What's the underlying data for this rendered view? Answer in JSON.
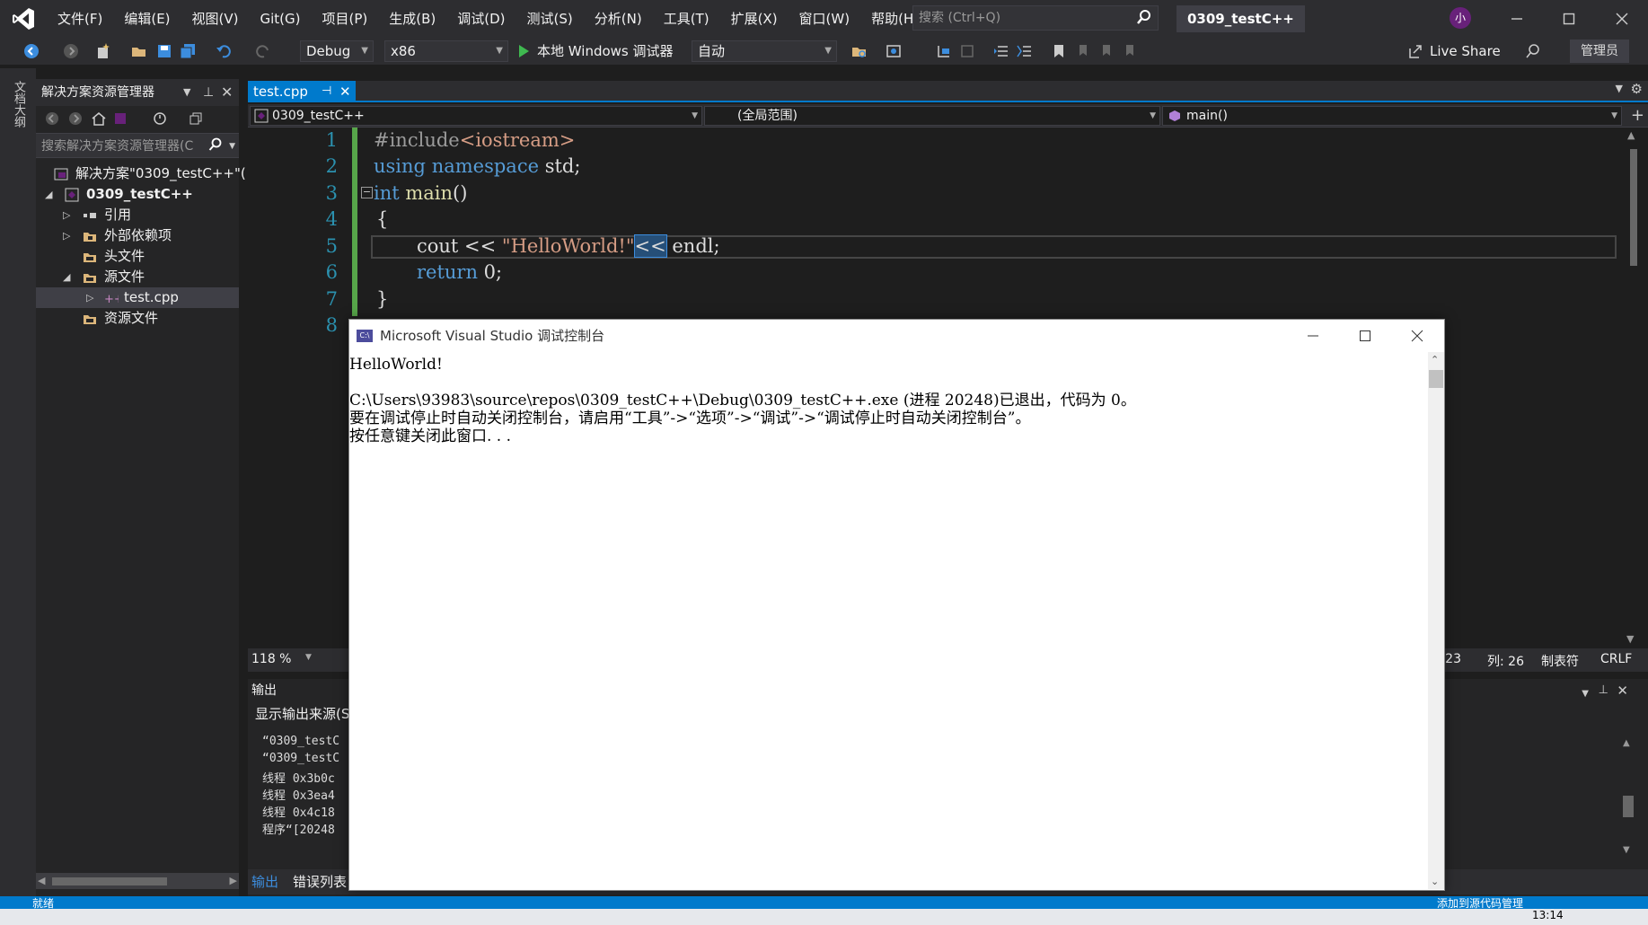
{
  "titlebar": {
    "menu": [
      "文件(F)",
      "编辑(E)",
      "视图(V)",
      "Git(G)",
      "项目(P)",
      "生成(B)",
      "调试(D)",
      "测试(S)",
      "分析(N)",
      "工具(T)",
      "扩展(X)",
      "窗口(W)",
      "帮助(H)"
    ],
    "search_placeholder": "搜索 (Ctrl+Q)",
    "solution_name": "0309_testC++",
    "user_initial": "小"
  },
  "toolbar": {
    "config": "Debug",
    "platform": "x86",
    "run_label": "本地 Windows 调试器",
    "auto": "自动",
    "live_share": "Live Share",
    "admin": "管理员"
  },
  "left_rail": {
    "tab": "文档大纲"
  },
  "solution_explorer": {
    "title": "解决方案资源管理器",
    "search_placeholder": "搜索解决方案资源管理器(C",
    "tree": [
      {
        "label": "解决方案\"0309_testC++\"(",
        "arrow": "",
        "icon": "solution-icon"
      },
      {
        "label": "0309_testC++",
        "arrow": "◢",
        "icon": "project-icon"
      },
      {
        "label": "引用",
        "arrow": "▷",
        "icon": "references-icon"
      },
      {
        "label": "外部依赖项",
        "arrow": "▷",
        "icon": "external-deps-icon"
      },
      {
        "label": "头文件",
        "arrow": "",
        "icon": "folder-icon"
      },
      {
        "label": "源文件",
        "arrow": "◢",
        "icon": "folder-icon"
      },
      {
        "label": "test.cpp",
        "arrow": "▷",
        "icon": "cpp-file-icon"
      },
      {
        "label": "资源文件",
        "arrow": "",
        "icon": "folder-icon"
      }
    ]
  },
  "editor": {
    "tab": "test.cpp",
    "nav_project": "0309_testC++",
    "nav_scope": "(全局范围)",
    "nav_member": "main()",
    "line_numbers": [
      "1",
      "2",
      "3",
      "4",
      "5",
      "6",
      "7",
      "8"
    ],
    "code": {
      "l1_pp": "#include",
      "l1_inc": "<iostream>",
      "l2_kw1": "using",
      "l2_kw2": "namespace",
      "l2_rest": " std;",
      "l3_kw": "int",
      "l3_fn": " main",
      "l3_rest": "()",
      "l4": "{",
      "l5_a": "cout << ",
      "l5_str": "\"HelloWorld!\"",
      "l5_b": "<<",
      "l5_c": " endl;",
      "l6_kw": "return",
      "l6_rest": " 0;",
      "l7": "}"
    },
    "zoom": "118 %",
    "line_col_partial": ": 23",
    "col": "列: 26",
    "tab_mode": "制表符",
    "eol": "CRLF"
  },
  "output": {
    "title": "输出",
    "source_label": "显示输出来源(S",
    "lines": [
      "“0309_testC",
      "“0309_testC",
      "线程 0x3b0c",
      "线程 0x3ea4",
      "线程 0x4c18",
      "程序“[20248"
    ],
    "tabs": [
      "输出",
      "错误列表"
    ]
  },
  "console": {
    "title": "Microsoft Visual Studio 调试控制台",
    "icon_text": "C:\\",
    "lines": [
      "HelloWorld!",
      "",
      "C:\\Users\\93983\\source\\repos\\0309_testC++\\Debug\\0309_testC++.exe (进程 20248)已退出，代码为 0。",
      "要在调试停止时自动关闭控制台，请启用“工具”->“选项”->“调试”->“调试停止时自动关闭控制台”。",
      "按任意键关闭此窗口. . ."
    ]
  },
  "statusbar": {
    "text": "就绪",
    "right_text": "添加到源代码管理"
  },
  "taskbar": {
    "time": "13:14"
  },
  "colors": {
    "accent": "#007acc",
    "editor_bg": "#1e1e1e",
    "chrome_bg": "#2d2d30",
    "keyword": "#569cd6",
    "string": "#d69d85",
    "line_number": "#2b91af"
  }
}
